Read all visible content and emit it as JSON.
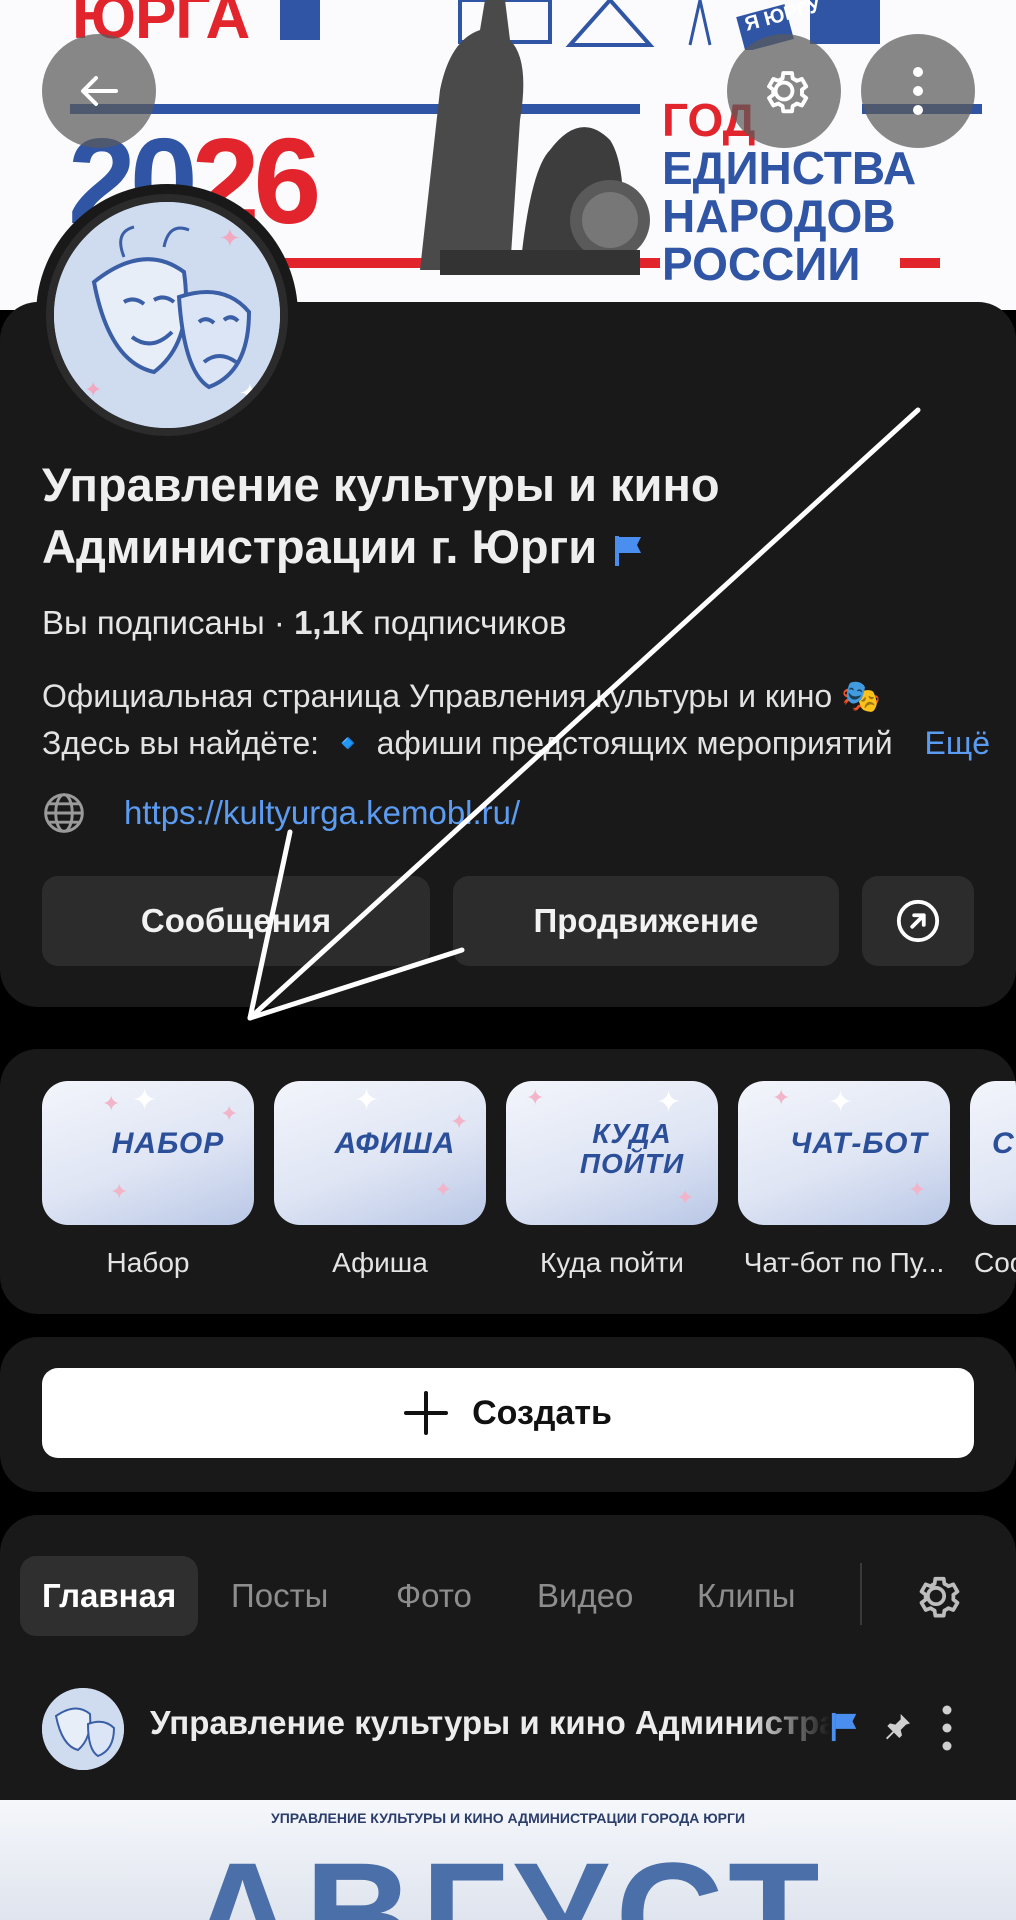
{
  "cover": {
    "logo_text": "ЮРГА",
    "year_left": "20",
    "year_right": "26",
    "slogan_lines": [
      "ГОД",
      "ЕДИНСТВА",
      "НАРОДОВ",
      "РОССИИ"
    ],
    "badge_top": "Я",
    "badge_text": "ЮРГУ"
  },
  "header": {
    "back_icon": "arrow-left-icon",
    "settings_icon": "gear-icon",
    "more_icon": "vertical-dots-icon"
  },
  "profile": {
    "name": "Управление культуры и кино Администрации г. Юрги",
    "subscribed": "Вы подписаны",
    "separator": " · ",
    "subscriber_count": "1,1K",
    "subscriber_word": " подписчиков",
    "description_line1": "Официальная страница Управления культуры и кино 🎭",
    "description_line2": "Здесь вы найдёте: 🔹 афиши предстоящих мероприятий",
    "more_label": "Ещё",
    "website": "https://kultyurga.kemobl.ru/"
  },
  "actions": {
    "messages_label": "Сообщения",
    "promotion_label": "Продвижение",
    "share_icon": "share-arrow-icon"
  },
  "stories": [
    {
      "thumb_text": "НАБОР",
      "label": "Набор"
    },
    {
      "thumb_text": "АФИША",
      "label": "Афиша"
    },
    {
      "thumb_text": "КУДА ПОЙТИ",
      "label": "Куда пойти"
    },
    {
      "thumb_text": "ЧАТ-БОТ",
      "label": "Чат-бот по Пу..."
    },
    {
      "thumb_text": "СО О",
      "label": "Соо"
    }
  ],
  "create": {
    "label": "Создать"
  },
  "tabs": [
    "Главная",
    "Посты",
    "Фото",
    "Видео",
    "Клипы"
  ],
  "post": {
    "author": "Управление культуры и кино Администрации г. Юрги",
    "image_caption": "УПРАВЛЕНИЕ КУЛЬТУРЫ И КИНО АДМИНИСТРАЦИИ ГОРОДА ЮРГИ",
    "image_title": "АВГУСТ"
  },
  "colors": {
    "background": "#000000",
    "card": "#191919",
    "button": "#2c2c2c",
    "link": "#5b9cf2",
    "brand_blue": "#2f55a4",
    "brand_red": "#e2252c"
  }
}
